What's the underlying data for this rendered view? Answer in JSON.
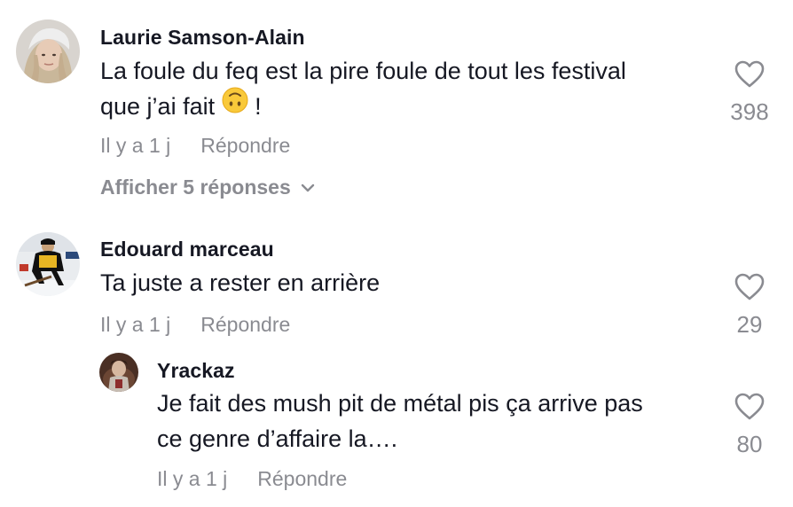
{
  "comments": [
    {
      "username": "Laurie Samson-Alain",
      "text_line1": "La foule du feq est la pire foule de tout les festival",
      "text_line2_before": "que j’ai fait ",
      "text_line2_emoji_icon": "upside-down-face-emoji",
      "text_line2_after": " !",
      "time": "Il y a 1 j",
      "reply_label": "Répondre",
      "likes": "398",
      "view_replies_label": "Afficher 5 réponses"
    },
    {
      "username": "Edouard marceau",
      "text_line1": "Ta juste a rester en arrière",
      "time": "Il y a 1 j",
      "reply_label": "Répondre",
      "likes": "29"
    },
    {
      "username": "Yrackaz",
      "text_line1": "Je fait des mush pit de métal pis ça arrive pas",
      "text_line2": "ce genre d’affaire la….",
      "time": "Il y a 1 j",
      "reply_label": "Répondre",
      "likes": "80"
    }
  ],
  "icons": {
    "like": "heart-outline-icon",
    "expand": "chevron-down-icon"
  },
  "colors": {
    "primary_text": "#161823",
    "secondary_text": "#8a8b91"
  }
}
